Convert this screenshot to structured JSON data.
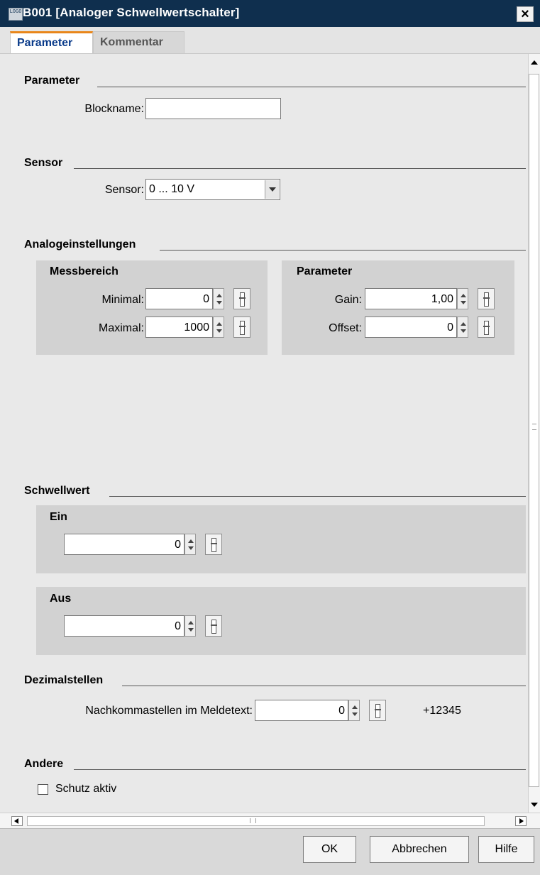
{
  "window": {
    "title": "B001 [Analoger Schwellwertschalter]",
    "icon_text": "LOGO",
    "close_label": "×"
  },
  "tabs": [
    {
      "label": "Parameter",
      "active": true
    },
    {
      "label": "Kommentar",
      "active": false
    }
  ],
  "parameter_section": {
    "title": "Parameter",
    "blockname_label": "Blockname:",
    "blockname_value": ""
  },
  "sensor_section": {
    "title": "Sensor",
    "sensor_label": "Sensor:",
    "sensor_value": "0 ... 10 V"
  },
  "analog_section": {
    "title": "Analogeinstellungen",
    "messbereich": {
      "title": "Messbereich",
      "minimal_label": "Minimal:",
      "minimal_value": "0",
      "maximal_label": "Maximal:",
      "maximal_value": "1000"
    },
    "parameter": {
      "title": "Parameter",
      "gain_label": "Gain:",
      "gain_value": "1,00",
      "offset_label": "Offset:",
      "offset_value": "0"
    }
  },
  "threshold_section": {
    "title": "Schwellwert",
    "ein_label": "Ein",
    "ein_value": "0",
    "aus_label": "Aus",
    "aus_value": "0"
  },
  "decimal_section": {
    "title": "Dezimalstellen",
    "label": "Nachkommastellen im Meldetext:",
    "value": "0",
    "preview": "+12345"
  },
  "other_section": {
    "title": "Andere",
    "protection_label": "Schutz aktiv",
    "protection_checked": false
  },
  "buttons": {
    "ok": "OK",
    "cancel": "Abbrechen",
    "help": "Hilfe"
  },
  "colors": {
    "titlebar": "#0f2f4e",
    "active_tab_text": "#0a3b8a",
    "active_tab_accent": "#e8861a",
    "content_bg": "#e9e9e9",
    "panel_bg": "#d2d2d2"
  }
}
